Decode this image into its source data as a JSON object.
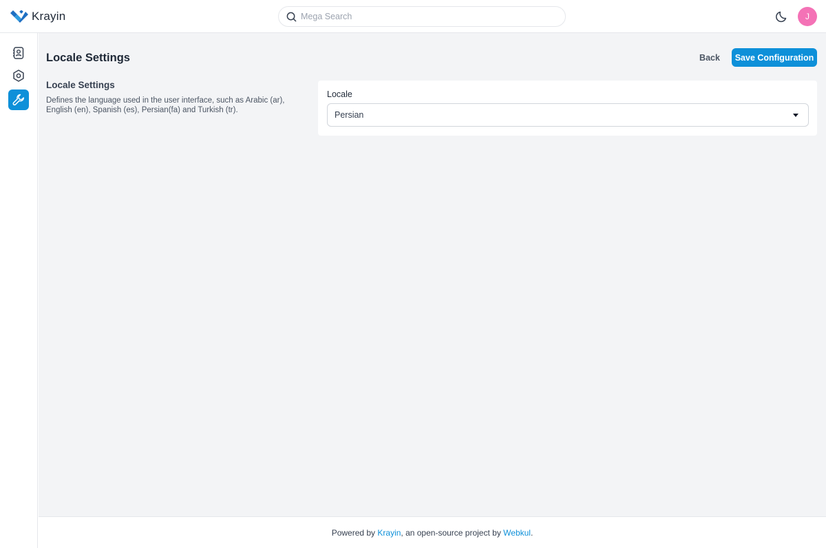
{
  "app": {
    "name": "Krayin"
  },
  "header": {
    "search_placeholder": "Mega Search",
    "theme_icon": "moon-icon",
    "avatar_initial": "J",
    "avatar_color": "#f472b6"
  },
  "sidebar": {
    "items": [
      {
        "icon": "contacts-icon",
        "active": false
      },
      {
        "icon": "settings-icon",
        "active": false
      },
      {
        "icon": "wrench-icon",
        "active": true
      }
    ],
    "accent": "#0e90d9"
  },
  "page": {
    "title": "Locale Settings",
    "back_label": "Back",
    "save_label": "Save Configuration"
  },
  "section": {
    "title": "Locale Settings",
    "description": "Defines the language used in the user interface, such as Arabic (ar), English (en), Spanish (es), Persian(fa) and Turkish (tr)."
  },
  "form": {
    "locale_label": "Locale",
    "locale_value": "Persian"
  },
  "footer": {
    "prefix": "Powered by ",
    "krayin_link": "Krayin",
    "middle": ", an open-source project by ",
    "webkul_link": "Webkul",
    "suffix": "."
  }
}
